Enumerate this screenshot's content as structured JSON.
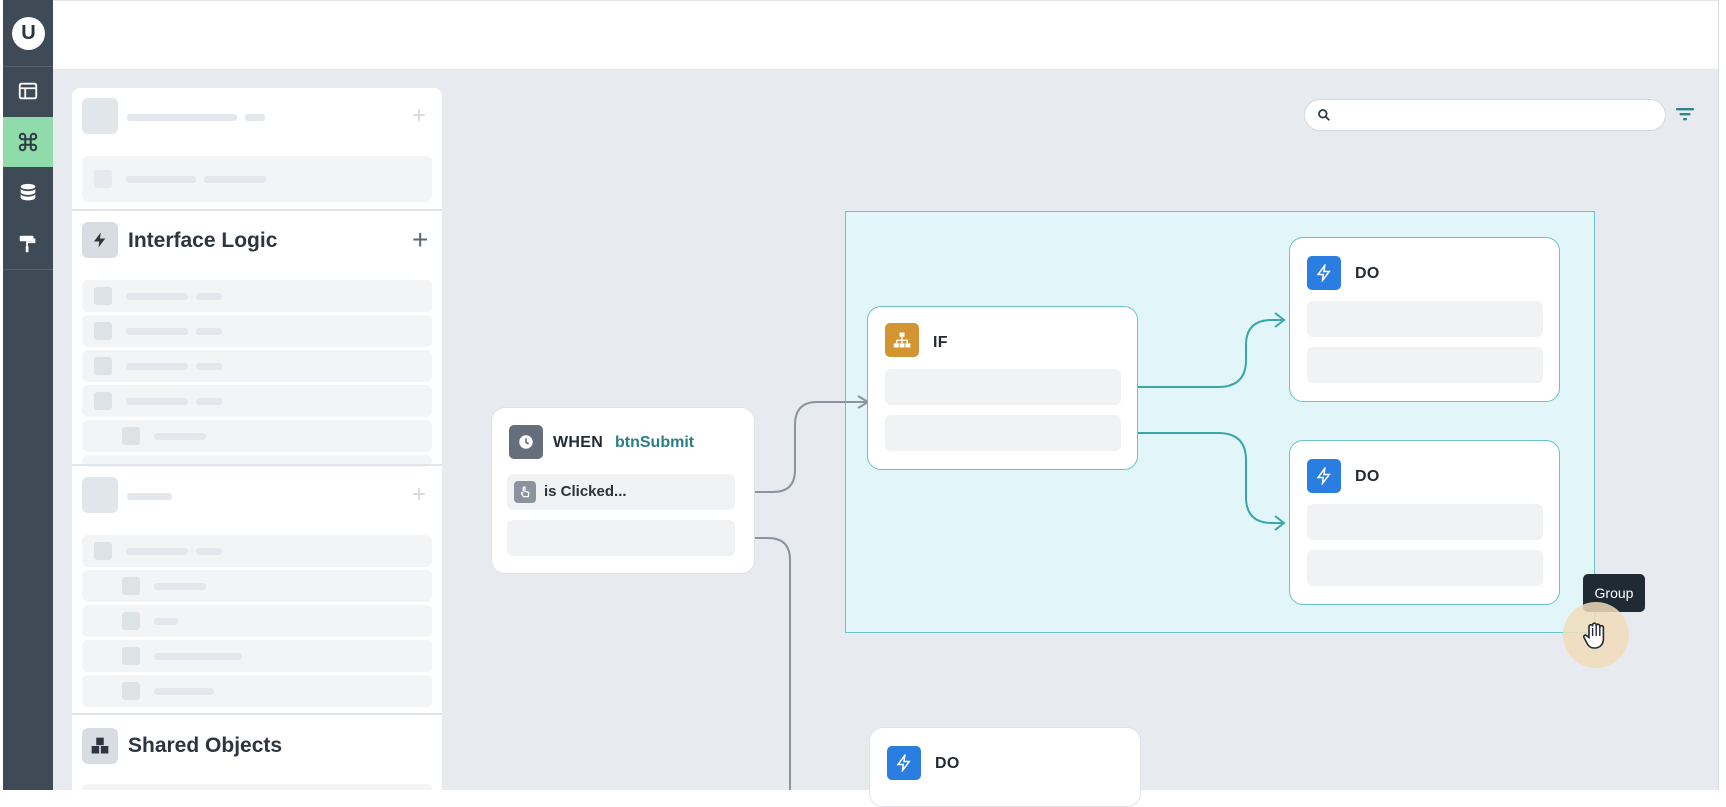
{
  "app": {
    "logo_letter": "U",
    "accent": "#8fdcaa"
  },
  "rail": {
    "items": [
      {
        "icon": "layout-icon",
        "active": false
      },
      {
        "icon": "command-icon",
        "active": true
      },
      {
        "icon": "database-icon",
        "active": false
      },
      {
        "icon": "paint-roller-icon",
        "active": false
      }
    ]
  },
  "search": {
    "placeholder": "",
    "value": ""
  },
  "panel": {
    "sections": [
      {
        "title": "Interface Logic",
        "icon": "lightning-icon",
        "add_icon": "plus-icon"
      },
      {
        "title": "Shared Objects",
        "icon": "boxes-icon"
      }
    ]
  },
  "flow": {
    "when": {
      "keyword": "WHEN",
      "target": "btnSubmit",
      "event": "is Clicked...",
      "icon": "clock-icon"
    },
    "if": {
      "keyword": "IF",
      "icon": "hierarchy-icon"
    },
    "do_nodes": [
      {
        "keyword": "DO",
        "icon": "lightning-icon"
      },
      {
        "keyword": "DO",
        "icon": "lightning-icon"
      },
      {
        "keyword": "DO",
        "icon": "lightning-icon"
      }
    ],
    "group_tooltip": "Group",
    "colors": {
      "connector_teal": "#3aa6aa",
      "connector_gray": "#8a949e",
      "if_icon": "#d39532",
      "do_icon": "#2a7de1",
      "when_icon": "#646f7b"
    }
  }
}
